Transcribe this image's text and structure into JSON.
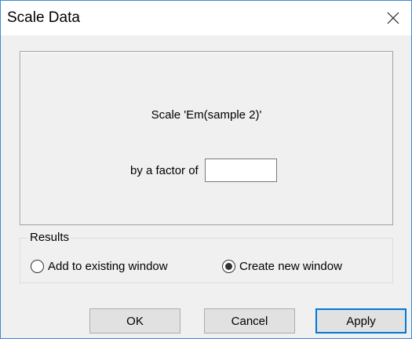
{
  "window": {
    "title": "Scale Data",
    "close_icon": "close-icon"
  },
  "panel": {
    "scale_text": "Scale 'Em(sample 2)'",
    "factor_label": "by a factor of",
    "factor_value": ""
  },
  "results": {
    "legend": "Results",
    "options": [
      {
        "label": "Add to existing window",
        "selected": false
      },
      {
        "label": "Create new window",
        "selected": true
      }
    ]
  },
  "buttons": {
    "ok": "OK",
    "cancel": "Cancel",
    "apply": "Apply"
  },
  "colors": {
    "window_border": "#3c8ad6",
    "dialog_bg": "#f0f0f0",
    "default_button_border": "#0078d7"
  }
}
